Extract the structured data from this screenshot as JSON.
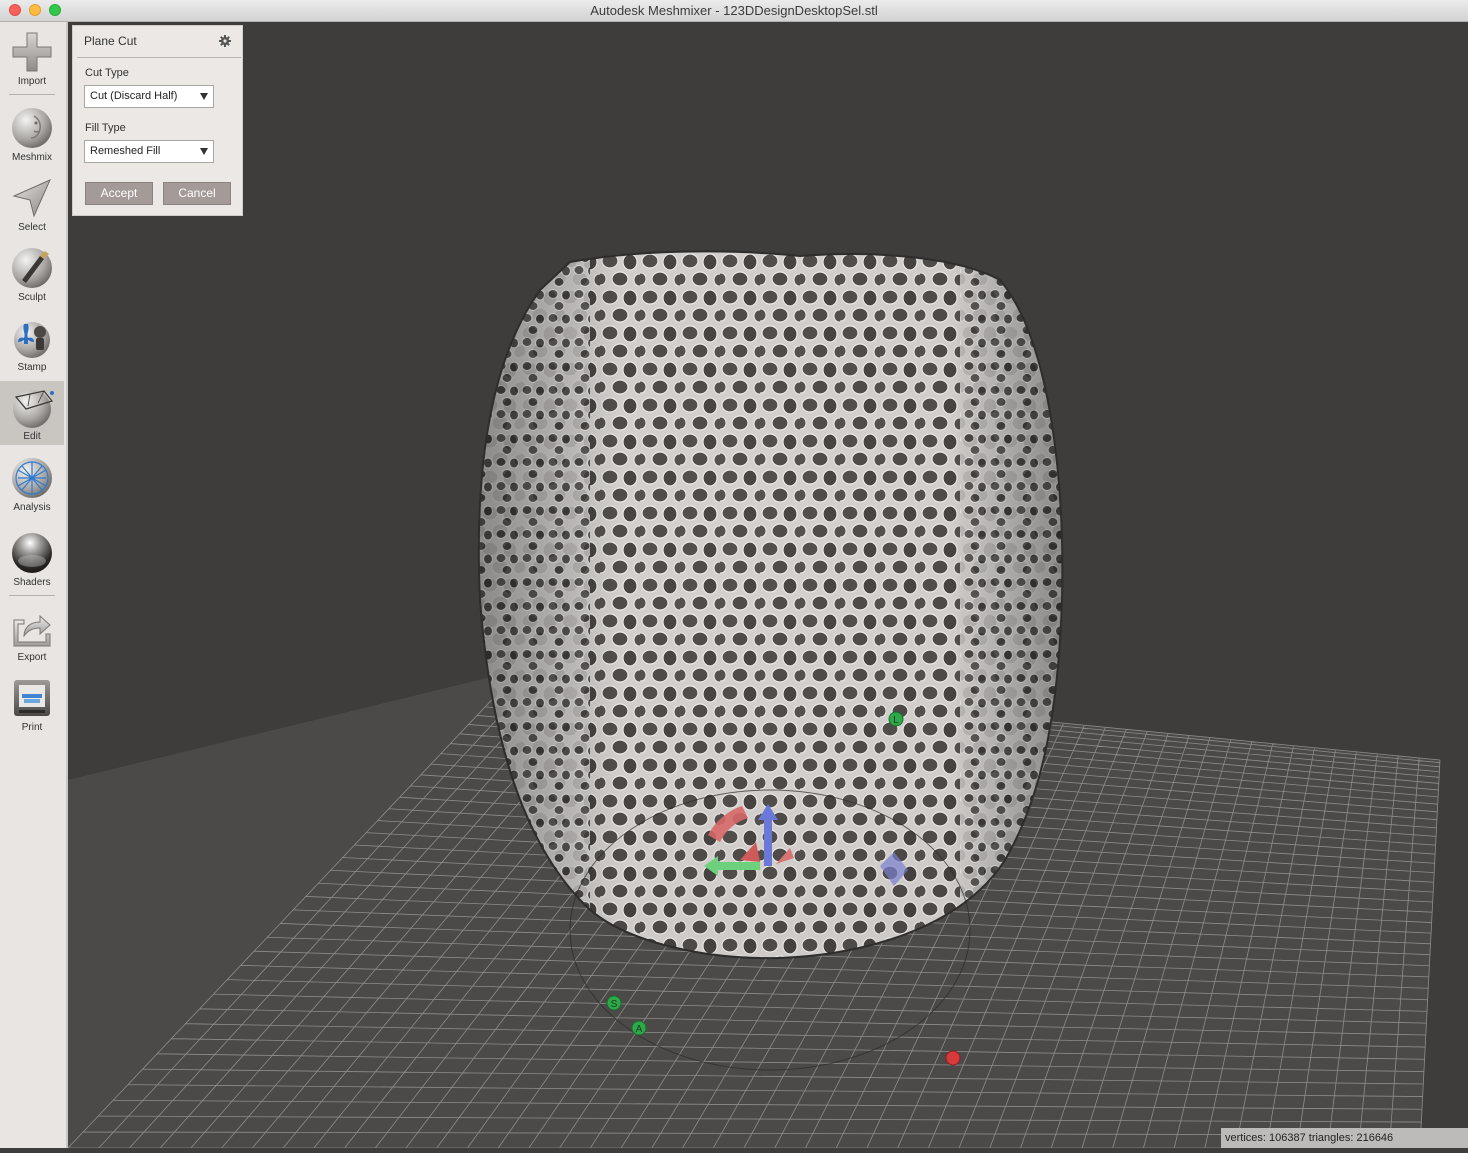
{
  "window": {
    "title": "Autodesk Meshmixer - 123DDesignDesktopSel.stl"
  },
  "toolbar": {
    "items": [
      {
        "label": "Import",
        "icon": "plus-icon"
      },
      {
        "label": "Meshmix",
        "icon": "meshmix-face-icon"
      },
      {
        "label": "Select",
        "icon": "select-arrow-icon"
      },
      {
        "label": "Sculpt",
        "icon": "sculpt-brush-icon"
      },
      {
        "label": "Stamp",
        "icon": "stamp-fleur-icon"
      },
      {
        "label": "Edit",
        "icon": "edit-sphere-icon",
        "active": true
      },
      {
        "label": "Analysis",
        "icon": "analysis-sphere-icon"
      },
      {
        "label": "Shaders",
        "icon": "shader-sphere-icon"
      },
      {
        "label": "Export",
        "icon": "export-icon"
      },
      {
        "label": "Print",
        "icon": "printer-icon"
      }
    ]
  },
  "panel": {
    "title": "Plane Cut",
    "cut_type_label": "Cut Type",
    "cut_type_value": "Cut (Discard Half)",
    "fill_type_label": "Fill Type",
    "fill_type_value": "Remeshed Fill",
    "accept_label": "Accept",
    "cancel_label": "Cancel"
  },
  "viewport": {
    "gizmo_handles": [
      "L",
      "S",
      "A"
    ]
  },
  "status": {
    "text": "vertices: 106387 triangles: 216646"
  }
}
